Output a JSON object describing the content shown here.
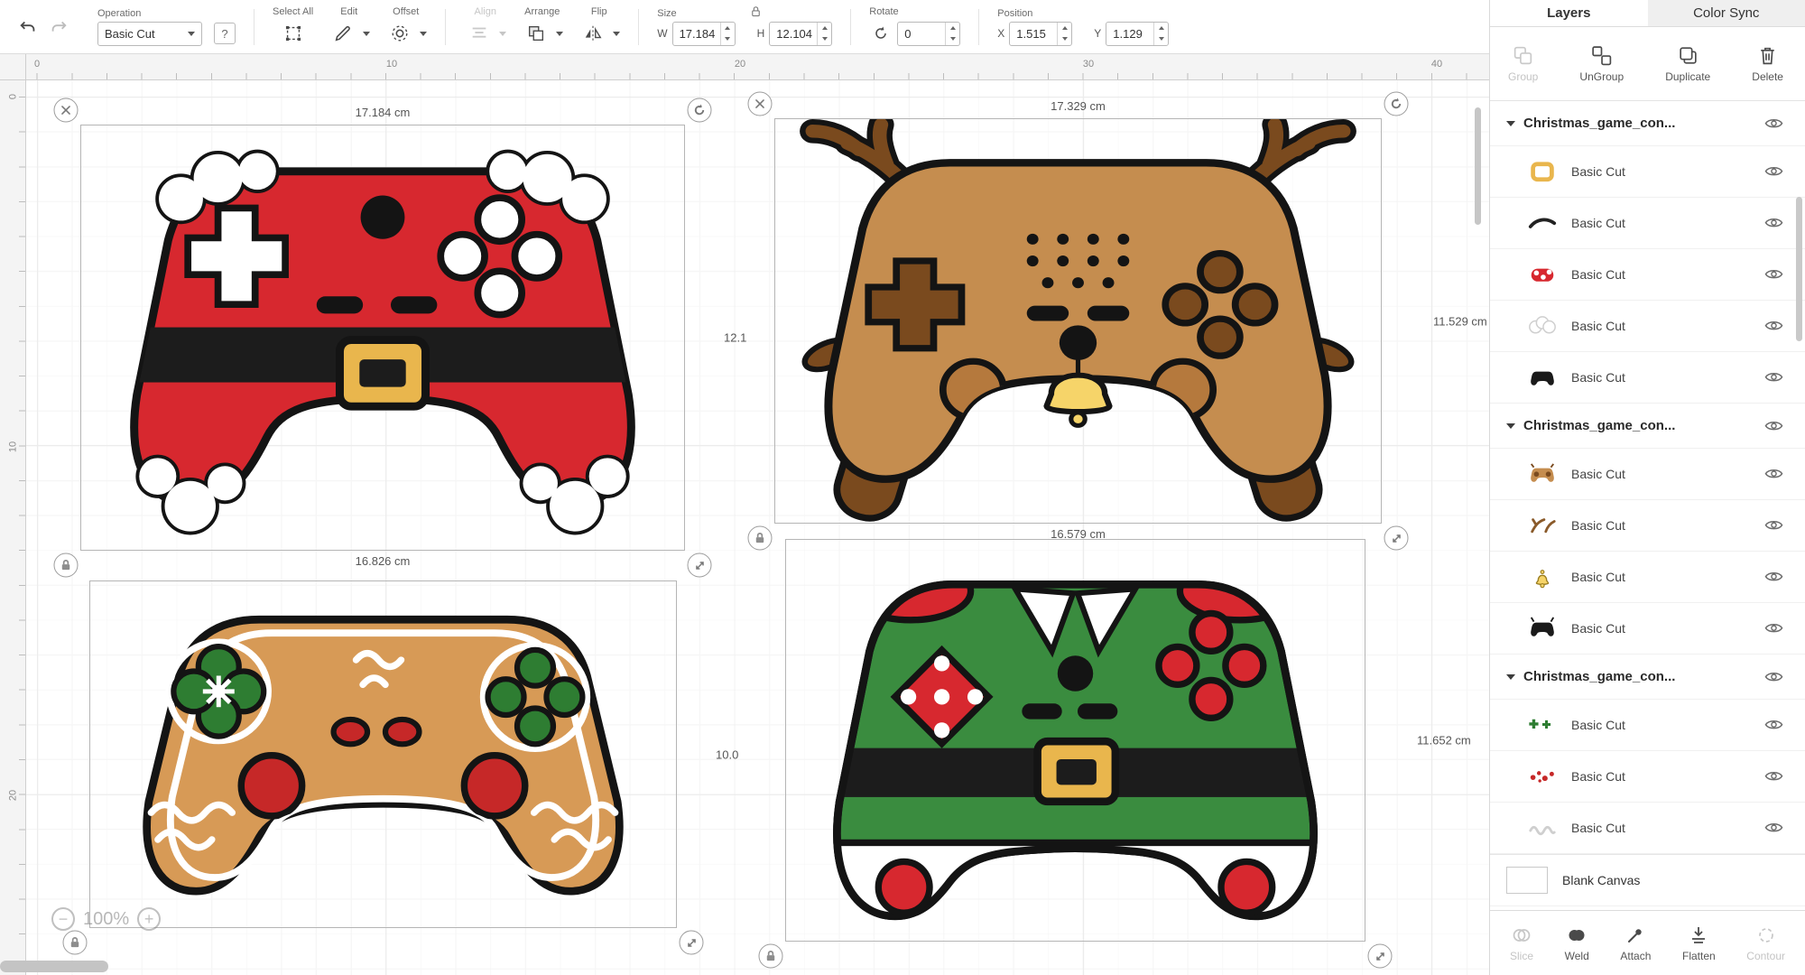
{
  "toolbar": {
    "operation_label": "Operation",
    "operation_value": "Basic Cut",
    "help_label": "?",
    "select_all_label": "Select All",
    "edit_label": "Edit",
    "offset_label": "Offset",
    "align_label": "Align",
    "arrange_label": "Arrange",
    "flip_label": "Flip",
    "size_label": "Size",
    "w_label": "W",
    "w_value": "17.184",
    "h_label": "H",
    "h_value": "12.104",
    "rotate_label": "Rotate",
    "rotate_value": "0",
    "position_label": "Position",
    "x_label": "X",
    "x_value": "1.515",
    "y_label": "Y",
    "y_value": "1.129"
  },
  "rulers": {
    "horizontal": [
      "0",
      "10",
      "20",
      "30",
      "40"
    ],
    "vertical": [
      "0",
      "10",
      "20"
    ]
  },
  "canvas": {
    "zoom_label": "100%",
    "objects": {
      "santa": {
        "top_dim": "17.184 cm",
        "right_dim": "12.1",
        "bottom_dim": "16.826 cm"
      },
      "reindeer": {
        "top_dim": "17.329 cm",
        "right_dim": "11.529 cm",
        "bottom_dim": "16.579 cm"
      },
      "gingerbread": {
        "right_dim": "10.0"
      },
      "elf": {
        "right_dim": "11.652 cm"
      }
    }
  },
  "panel": {
    "tabs": {
      "layers": "Layers",
      "color_sync": "Color Sync"
    },
    "actions": {
      "group": "Group",
      "ungroup": "UnGroup",
      "duplicate": "Duplicate",
      "delete": "Delete"
    },
    "groups": [
      {
        "title": "Christmas_game_con...",
        "items": [
          "Basic Cut",
          "Basic Cut",
          "Basic Cut",
          "Basic Cut",
          "Basic Cut"
        ]
      },
      {
        "title": "Christmas_game_con...",
        "items": [
          "Basic Cut",
          "Basic Cut",
          "Basic Cut",
          "Basic Cut"
        ]
      },
      {
        "title": "Christmas_game_con...",
        "items": [
          "Basic Cut",
          "Basic Cut",
          "Basic Cut"
        ]
      }
    ],
    "blank_canvas_label": "Blank Canvas",
    "bottom_actions": {
      "slice": "Slice",
      "weld": "Weld",
      "attach": "Attach",
      "flatten": "Flatten",
      "contour": "Contour"
    }
  },
  "colors": {
    "santa_red": "#d7282f",
    "gold_buckle": "#e9b64d",
    "reindeer_brown": "#c58d4f",
    "dark_brown": "#7a4a1e",
    "gingerbread_tan": "#d79a56",
    "elf_green": "#3a8c3f",
    "button_green": "#2e7d32",
    "berry_red": "#c62828",
    "bell_gold": "#f6d469"
  }
}
